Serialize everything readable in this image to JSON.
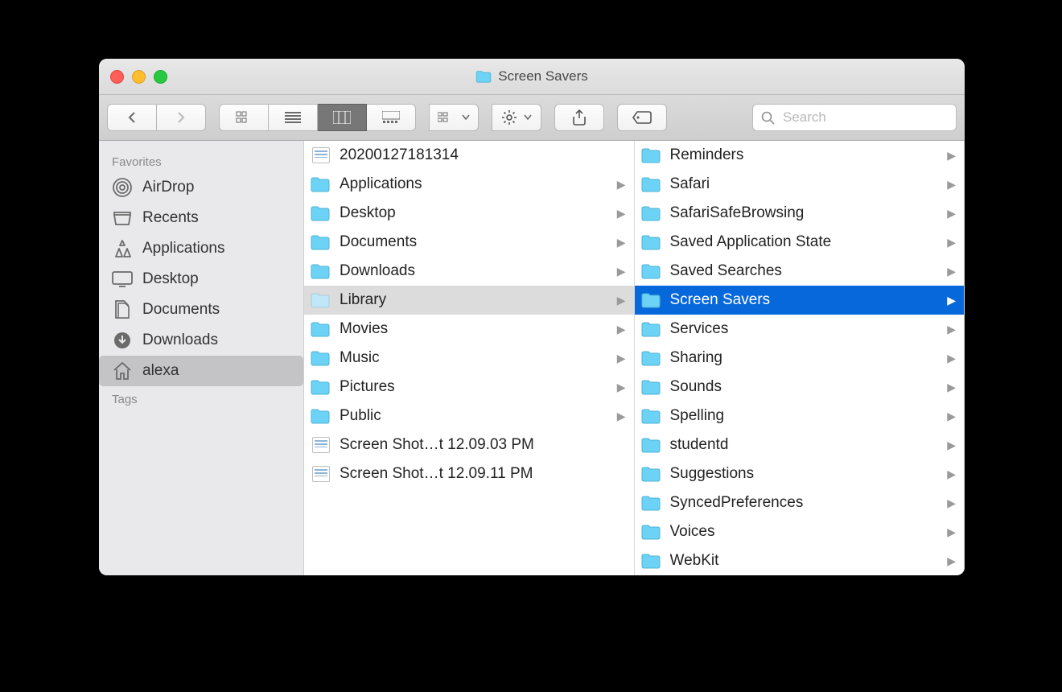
{
  "window": {
    "title": "Screen Savers"
  },
  "toolbar": {
    "search_placeholder": "Search"
  },
  "sidebar": {
    "sections": [
      {
        "heading": "Favorites",
        "items": [
          {
            "label": "AirDrop",
            "icon": "airdrop",
            "selected": false
          },
          {
            "label": "Recents",
            "icon": "recents",
            "selected": false
          },
          {
            "label": "Applications",
            "icon": "applications",
            "selected": false
          },
          {
            "label": "Desktop",
            "icon": "desktop",
            "selected": false
          },
          {
            "label": "Documents",
            "icon": "documents",
            "selected": false
          },
          {
            "label": "Downloads",
            "icon": "downloads",
            "selected": false
          },
          {
            "label": "alexa",
            "icon": "home",
            "selected": true
          }
        ]
      },
      {
        "heading": "Tags",
        "items": []
      }
    ]
  },
  "columns": [
    {
      "items": [
        {
          "label": "20200127181314",
          "type": "file"
        },
        {
          "label": "Applications",
          "type": "folder"
        },
        {
          "label": "Desktop",
          "type": "folder"
        },
        {
          "label": "Documents",
          "type": "folder"
        },
        {
          "label": "Downloads",
          "type": "folder"
        },
        {
          "label": "Library",
          "type": "folder",
          "state": "open"
        },
        {
          "label": "Movies",
          "type": "folder"
        },
        {
          "label": "Music",
          "type": "folder"
        },
        {
          "label": "Pictures",
          "type": "folder"
        },
        {
          "label": "Public",
          "type": "folder"
        },
        {
          "label": "Screen Shot…t 12.09.03 PM",
          "type": "file"
        },
        {
          "label": "Screen Shot…t 12.09.11 PM",
          "type": "file"
        }
      ]
    },
    {
      "items": [
        {
          "label": "Reminders",
          "type": "folder"
        },
        {
          "label": "Safari",
          "type": "folder"
        },
        {
          "label": "SafariSafeBrowsing",
          "type": "folder"
        },
        {
          "label": "Saved Application State",
          "type": "folder"
        },
        {
          "label": "Saved Searches",
          "type": "folder"
        },
        {
          "label": "Screen Savers",
          "type": "folder",
          "state": "selected"
        },
        {
          "label": "Services",
          "type": "folder"
        },
        {
          "label": "Sharing",
          "type": "folder"
        },
        {
          "label": "Sounds",
          "type": "folder"
        },
        {
          "label": "Spelling",
          "type": "folder"
        },
        {
          "label": "studentd",
          "type": "folder"
        },
        {
          "label": "Suggestions",
          "type": "folder"
        },
        {
          "label": "SyncedPreferences",
          "type": "folder"
        },
        {
          "label": "Voices",
          "type": "folder"
        },
        {
          "label": "WebKit",
          "type": "folder"
        }
      ]
    }
  ]
}
